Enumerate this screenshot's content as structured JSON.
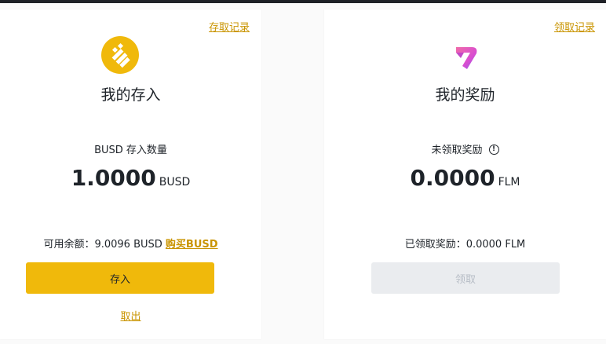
{
  "deposit_card": {
    "history_link": "存取记录",
    "icon": "busd-coin-icon",
    "title": "我的存入",
    "quantity_label": "BUSD 存入数量",
    "amount": "1.0000",
    "unit": "BUSD",
    "balance_label": "可用余额：9.0096 BUSD",
    "buy_link": "购买BUSD",
    "deposit_button": "存入",
    "cancel_link": "取出"
  },
  "reward_card": {
    "history_link": "领取记录",
    "icon": "flm-token-icon",
    "title": "我的奖励",
    "unclaimed_label": "未领取奖励",
    "amount": "0.0000",
    "unit": "FLM",
    "claimed_label": "已领取奖励：0.0000 FLM",
    "claim_button": "领取"
  },
  "colors": {
    "accent": "#f0b90b",
    "link": "#c99400",
    "disabled_bg": "#eaecef",
    "disabled_text": "#b7bdc6"
  }
}
